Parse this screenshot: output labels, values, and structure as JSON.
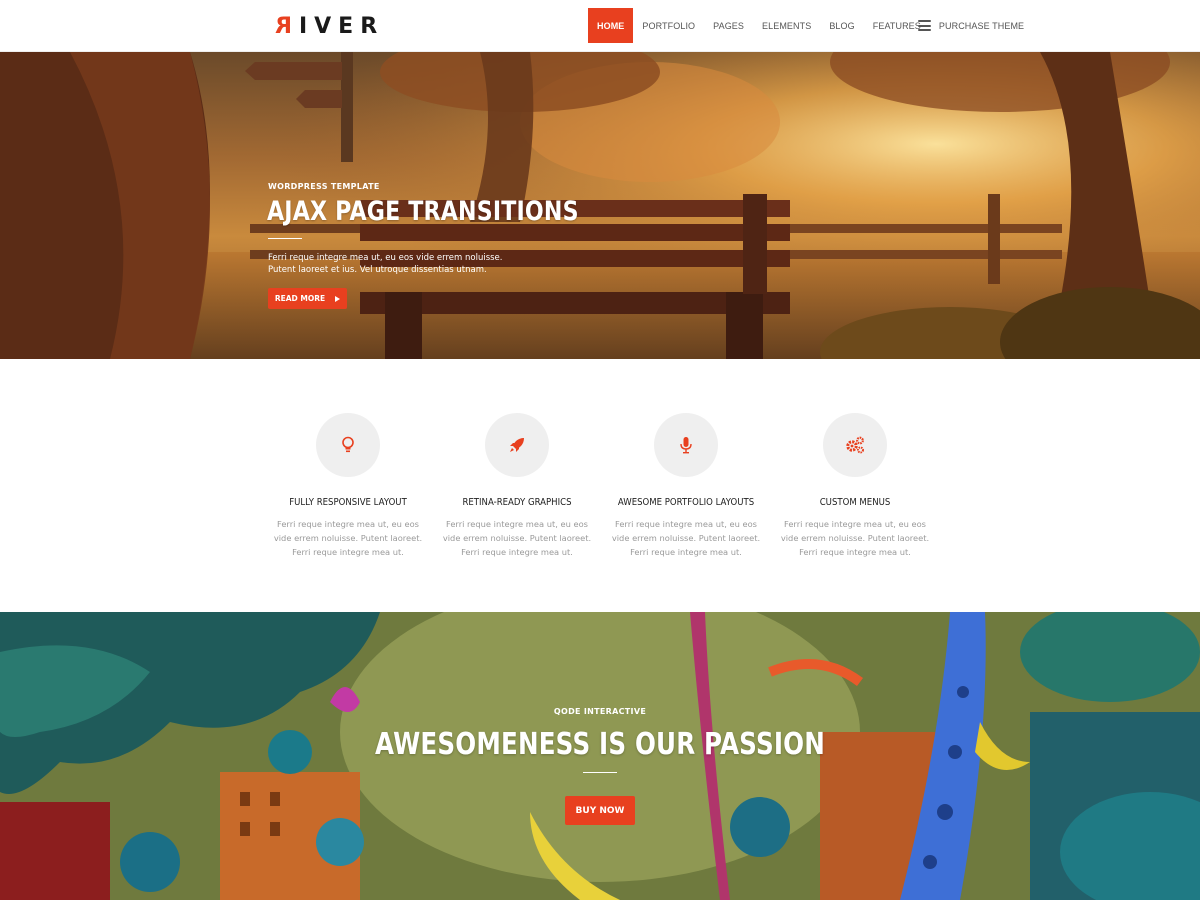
{
  "brand": {
    "logo_text": "IVER",
    "logo_mirrored_letter": "R"
  },
  "nav": {
    "items": [
      {
        "label": "HOME",
        "active": true
      },
      {
        "label": "PORTFOLIO"
      },
      {
        "label": "PAGES"
      },
      {
        "label": "ELEMENTS"
      },
      {
        "label": "BLOG"
      },
      {
        "label": "FEATURES"
      },
      {
        "label": "PURCHASE THEME"
      }
    ],
    "menu_icon": "hamburger-menu-icon"
  },
  "hero": {
    "eyebrow": "WORDPRESS TEMPLATE",
    "title": "AJAX PAGE TRANSITIONS",
    "text_line1": "Ferri reque integre mea ut, eu eos vide errem noluisse.",
    "text_line2": "Putent laoreet et ius. Vel utroque dissentias utnam.",
    "button_label": "READ MORE",
    "button_icon": "play-arrow-icon"
  },
  "features": [
    {
      "icon": "lightbulb-icon",
      "title": "FULLY RESPONSIVE LAYOUT",
      "text": "Ferri reque integre mea ut, eu eos vide errem noluisse. Putent laoreet. Ferri reque integre mea ut."
    },
    {
      "icon": "rocket-icon",
      "title": "RETINA-READY GRAPHICS",
      "text": "Ferri reque integre mea ut, eu eos vide errem noluisse. Putent laoreet. Ferri reque integre mea ut."
    },
    {
      "icon": "microphone-icon",
      "title": "AWESOME PORTFOLIO LAYOUTS",
      "text": "Ferri reque integre mea ut, eu eos vide errem noluisse. Putent laoreet. Ferri reque integre mea ut."
    },
    {
      "icon": "gears-icon",
      "title": "CUSTOM MENUS",
      "text": "Ferri reque integre mea ut, eu eos vide errem noluisse. Putent laoreet. Ferri reque integre mea ut."
    }
  ],
  "banner": {
    "eyebrow": "QODE INTERACTIVE",
    "title": "AWESOMENESS IS OUR PASSION",
    "button_label": "BUY NOW"
  },
  "colors": {
    "accent": "#e8401f",
    "feature_circle": "#efefef",
    "feature_text": "#9a9a9a"
  }
}
